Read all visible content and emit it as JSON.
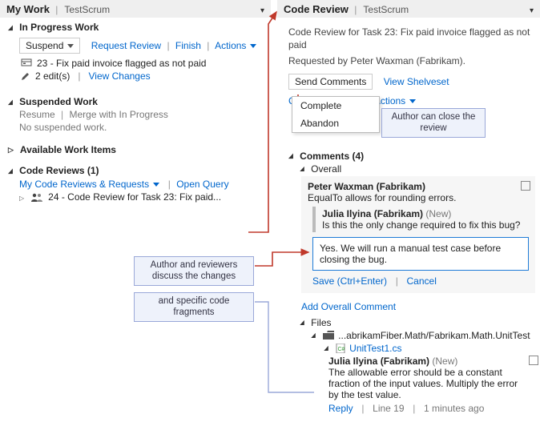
{
  "left": {
    "title": "My Work",
    "workspace": "TestScrum",
    "inprogress": {
      "heading": "In Progress Work",
      "suspend": "Suspend",
      "request": "Request Review",
      "finish": "Finish",
      "actions": "Actions",
      "item_id": "23",
      "item_title": "Fix paid invoice flagged as not paid",
      "edits": "2 edit(s)",
      "viewchanges": "View Changes"
    },
    "suspended": {
      "heading": "Suspended Work",
      "resume": "Resume",
      "merge": "Merge with In Progress",
      "empty": "No suspended work."
    },
    "available": {
      "heading": "Available Work Items"
    },
    "reviews": {
      "heading": "Code Reviews (1)",
      "mine": "My Code Reviews & Requests",
      "open": "Open Query",
      "item": "24 - Code Review for Task 23: Fix paid..."
    }
  },
  "right": {
    "title": "Code Review",
    "workspace": "TestScrum",
    "desc1": "Code Review for Task 23: Fix paid invoice flagged as not paid",
    "desc2": "Requested by Peter Waxman (Fabrikam).",
    "send": "Send Comments",
    "shelve": "View Shelveset",
    "close": "Close Review",
    "actions": "Actions",
    "menu": {
      "complete": "Complete",
      "abandon": "Abandon"
    },
    "comments_heading": "Comments (4)",
    "overall": "Overall",
    "c1_author": "Peter Waxman (Fabrikam)",
    "c1_text": "EqualTo allows for rounding errors.",
    "c2_author": "Julia Ilyina (Fabrikam)",
    "c2_new": "(New)",
    "c2_text": "Is this the only change required to fix this bug?",
    "reply_text": "Yes. We will run a manual test case before closing the bug.",
    "save": "Save (Ctrl+Enter)",
    "cancel": "Cancel",
    "add_overall": "Add Overall Comment",
    "files_heading": "Files",
    "folder": "...abrikamFiber.Math/Fabrikam.Math.UnitTest",
    "file": "UnitTest1.cs",
    "f_author": "Julia Ilyina (Fabrikam)",
    "f_new": "(New)",
    "f_text": "The allowable error should be a constant fraction of the input values. Multiply the error by the test value.",
    "reply": "Reply",
    "line": "Line 19",
    "time": "1 minutes ago"
  },
  "callouts": {
    "close": "Author can close the review",
    "discuss": "Author and reviewers discuss the changes",
    "fragments": "and specific code fragments"
  }
}
